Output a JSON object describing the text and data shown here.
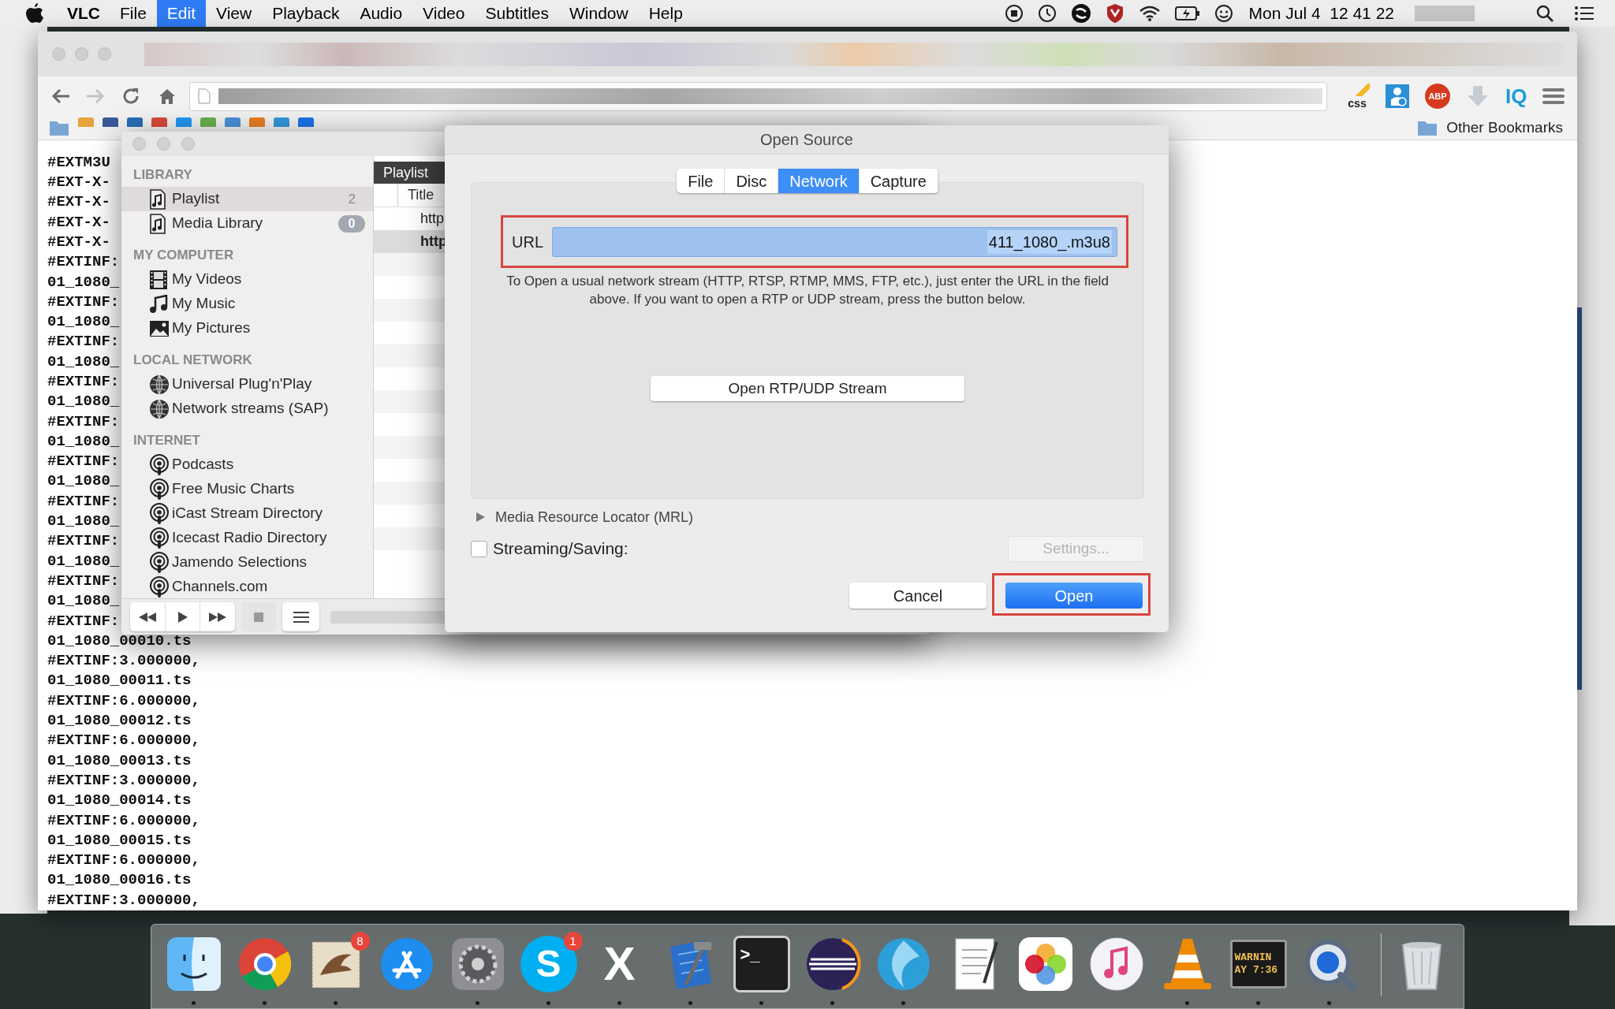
{
  "menu_bar": {
    "app": "VLC",
    "menus": [
      {
        "label": "File",
        "selected": false
      },
      {
        "label": "Edit",
        "selected": true
      },
      {
        "label": "View",
        "selected": false
      },
      {
        "label": "Playback",
        "selected": false
      },
      {
        "label": "Audio",
        "selected": false
      },
      {
        "label": "Video",
        "selected": false
      },
      {
        "label": "Subtitles",
        "selected": false
      },
      {
        "label": "Window",
        "selected": false
      },
      {
        "label": "Help",
        "selected": false
      }
    ],
    "clock": "Mon Jul 4  12 41 22"
  },
  "browser": {
    "extensions": [
      {
        "kind": "css",
        "label": "css"
      },
      {
        "kind": "person"
      },
      {
        "kind": "abp",
        "label": "ABP"
      },
      {
        "kind": "download"
      },
      {
        "kind": "iq",
        "label": "IQ"
      },
      {
        "kind": "menu"
      }
    ],
    "other_bookmarks": "Other Bookmarks",
    "document_lines": [
      "#EXTM3U",
      "#EXT-X-",
      "#EXT-X-",
      "#EXT-X-",
      "#EXT-X-",
      "#EXTINF:",
      "01_1080_",
      "#EXTINF:",
      "01_1080_",
      "#EXTINF:",
      "01_1080_",
      "#EXTINF:",
      "01_1080_",
      "#EXTINF:",
      "01_1080_",
      "#EXTINF:",
      "01_1080_",
      "#EXTINF:",
      "01_1080_",
      "#EXTINF:",
      "01_1080_",
      "#EXTINF:",
      "01_1080_",
      "#EXTINF:",
      "01_1080_00010.ts",
      "#EXTINF:3.000000,",
      "01_1080_00011.ts",
      "#EXTINF:6.000000,",
      "01_1080_00012.ts",
      "#EXTINF:6.000000,",
      "01_1080_00013.ts",
      "#EXTINF:3.000000,",
      "01_1080_00014.ts",
      "#EXTINF:6.000000,",
      "01_1080_00015.ts",
      "#EXTINF:6.000000,",
      "01_1080_00016.ts",
      "#EXTINF:3.000000,"
    ]
  },
  "vlc": {
    "sidebar": [
      {
        "heading": "LIBRARY",
        "items": [
          {
            "label": "Playlist",
            "kind": "music-file",
            "count": {
              "text": "2",
              "kind": "plain"
            },
            "selected": true
          },
          {
            "label": "Media Library",
            "kind": "music-file",
            "count": {
              "text": "0",
              "kind": "pill"
            },
            "selected": false
          }
        ]
      },
      {
        "heading": "MY COMPUTER",
        "items": [
          {
            "label": "My Videos",
            "kind": "film",
            "selected": false
          },
          {
            "label": "My Music",
            "kind": "note",
            "selected": false
          },
          {
            "label": "My Pictures",
            "kind": "picture",
            "selected": false
          }
        ]
      },
      {
        "heading": "LOCAL NETWORK",
        "items": [
          {
            "label": "Universal Plug'n'Play",
            "kind": "globe",
            "selected": false
          },
          {
            "label": "Network streams (SAP)",
            "kind": "globe",
            "selected": false
          }
        ]
      },
      {
        "heading": "INTERNET",
        "items": [
          {
            "label": "Podcasts",
            "kind": "podcast",
            "selected": false
          },
          {
            "label": "Free Music Charts",
            "kind": "podcast",
            "selected": false
          },
          {
            "label": "iCast Stream Directory",
            "kind": "podcast",
            "selected": false
          },
          {
            "label": "Icecast Radio Directory",
            "kind": "podcast",
            "selected": false
          },
          {
            "label": "Jamendo Selections",
            "kind": "podcast",
            "selected": false
          },
          {
            "label": "Channels.com",
            "kind": "podcast",
            "selected": false
          }
        ]
      }
    ],
    "playlist": {
      "title": "Playlist",
      "column": "Title",
      "rows": [
        {
          "text": "http",
          "selected": false
        },
        {
          "text": "http",
          "selected": true
        }
      ]
    }
  },
  "dialog": {
    "title": "Open Source",
    "tabs": [
      {
        "label": "File",
        "selected": false
      },
      {
        "label": "Disc",
        "selected": false
      },
      {
        "label": "Network",
        "selected": true
      },
      {
        "label": "Capture",
        "selected": false
      }
    ],
    "url": {
      "label": "URL",
      "value": "411_1080_.m3u8"
    },
    "help": "To Open a usual network stream (HTTP, RTSP, RTMP, MMS, FTP, etc.), just enter the URL in the field above. If you want to open a RTP or UDP stream, press the button below.",
    "rtp_button": "Open RTP/UDP Stream",
    "mrl": {
      "label": "Media Resource Locator (MRL)",
      "expanded": false
    },
    "streaming": {
      "label": "Streaming/Saving:",
      "checked": false
    },
    "settings": {
      "label": "Settings...",
      "disabled": true
    },
    "buttons": [
      {
        "label": "Cancel",
        "default": false
      },
      {
        "label": "Open",
        "default": true
      }
    ]
  },
  "dock": [
    {
      "kind": "finder",
      "running": true
    },
    {
      "kind": "chrome",
      "running": true
    },
    {
      "kind": "mail",
      "badge": "8",
      "running": true
    },
    {
      "kind": "appstore",
      "running": false
    },
    {
      "kind": "prefs",
      "running": true
    },
    {
      "kind": "skype",
      "glyph": "S",
      "badge": "1",
      "running": true
    },
    {
      "kind": "excel",
      "glyph": "X",
      "running": true
    },
    {
      "kind": "xcode",
      "running": true
    },
    {
      "kind": "terminal",
      "glyph": ">_",
      "running": true
    },
    {
      "kind": "eclipse",
      "running": true
    },
    {
      "kind": "swirl",
      "running": true
    },
    {
      "kind": "textedit",
      "running": false
    },
    {
      "kind": "photos",
      "running": false
    },
    {
      "kind": "itunes",
      "running": false
    },
    {
      "kind": "vlc",
      "running": true
    },
    {
      "kind": "console",
      "lines": [
        "WARNIN",
        "AY 7:36"
      ],
      "running": true
    },
    {
      "kind": "quicktime",
      "running": true
    },
    {
      "kind": "trash",
      "running": false
    }
  ]
}
